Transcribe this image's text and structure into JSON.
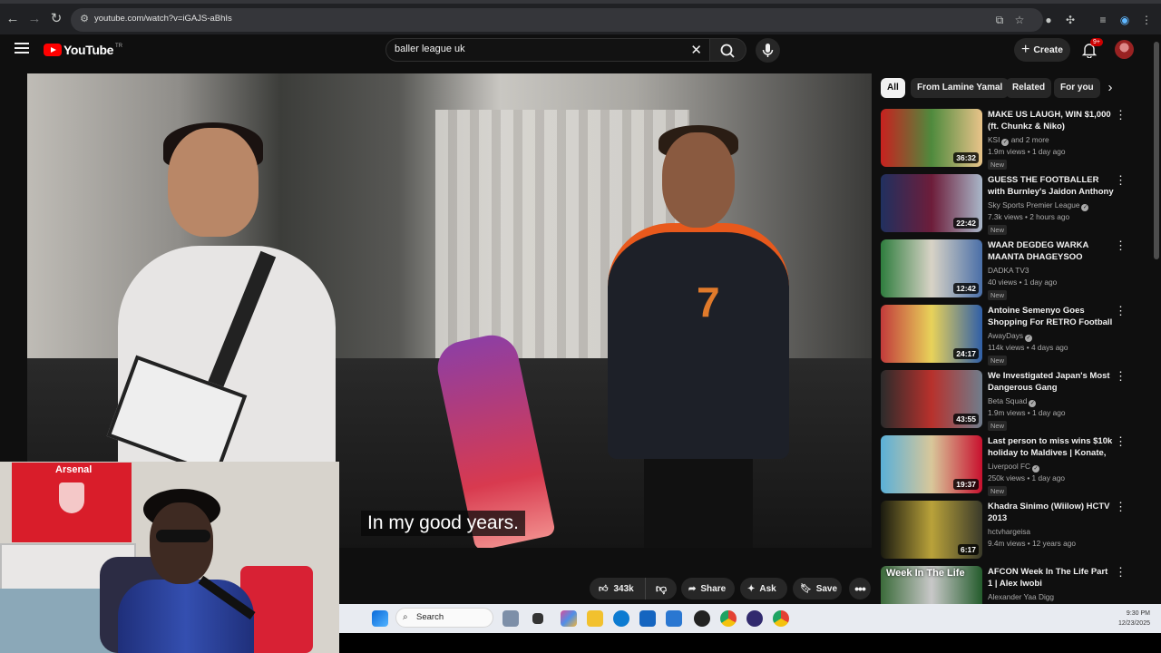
{
  "browser": {
    "url": "youtube.com/watch?v=iGAJS-aBhIs"
  },
  "header": {
    "logo_text": "YouTube",
    "logo_sup": "TR",
    "search_value": "baller league uk",
    "create_label": "Create",
    "notif_count": "9+"
  },
  "video": {
    "caption": "In my good years.",
    "jersey_number": "7"
  },
  "webcam": {
    "flag_text": "Arsenal"
  },
  "actions": {
    "like_count": "343k",
    "share": "Share",
    "ask": "Ask",
    "save": "Save"
  },
  "chips": [
    "All",
    "From Lamine Yamal",
    "Related",
    "For you"
  ],
  "recommendations": [
    {
      "title": "MAKE US LAUGH, WIN $1,000 (ft. Chunkz & Niko)",
      "channel": "KSI",
      "channel_extra": "and 2 more",
      "verified": true,
      "meta": "1.9m views • 1 day ago",
      "badge": "New",
      "duration": "36:32",
      "colors": [
        "#c8211f",
        "#4f8a3d",
        "#e9c48a"
      ]
    },
    {
      "title": "GUESS THE FOOTBALLER with Burnley's Jaidon Anthony & ...",
      "channel": "Sky Sports Premier League",
      "channel_extra": "",
      "verified": true,
      "meta": "7.3k views • 2 hours ago",
      "badge": "New",
      "duration": "22:42",
      "colors": [
        "#20305f",
        "#6d1d3a",
        "#a9b7c9"
      ]
    },
    {
      "title": "WAAR DEGDEG WARKA MAANTA DHAGEYSOO #XOGTA",
      "channel": "DADKA TV3",
      "channel_extra": "",
      "verified": false,
      "meta": "40 views • 1 day ago",
      "badge": "New",
      "duration": "12:42",
      "colors": [
        "#2f7d3e",
        "#d8d3c6",
        "#4a6fa8"
      ]
    },
    {
      "title": "Antoine Semenyo Goes Shopping For RETRO Football ...",
      "channel": "AwayDays",
      "channel_extra": "",
      "verified": true,
      "meta": "114k views • 4 days ago",
      "badge": "New",
      "duration": "24:17",
      "colors": [
        "#c23b3b",
        "#e8d25a",
        "#2f5fa8"
      ]
    },
    {
      "title": "We Investigated Japan's Most Dangerous Gang",
      "channel": "Beta Squad",
      "channel_extra": "",
      "verified": true,
      "meta": "1.9m views • 1 day ago",
      "badge": "New",
      "duration": "43:55",
      "colors": [
        "#2b2b2b",
        "#b8312c",
        "#6f7d8c"
      ]
    },
    {
      "title": "Last person to miss wins $10k holiday to Maldives | Konate, ...",
      "channel": "Liverpool FC",
      "channel_extra": "",
      "verified": true,
      "meta": "250k views • 1 day ago",
      "badge": "New",
      "duration": "19:37",
      "colors": [
        "#5ab0d8",
        "#d8c79a",
        "#c8102e"
      ]
    },
    {
      "title": "Khadra Sinimo (Wiilow) HCTV 2013",
      "channel": "hctvhargeisa",
      "channel_extra": "",
      "verified": false,
      "meta": "9.4m views • 12 years ago",
      "badge": "",
      "duration": "6:17",
      "colors": [
        "#1a1a10",
        "#b9a23a",
        "#3a3a2a"
      ]
    },
    {
      "title": "AFCON Week In The Life Part 1 | Alex Iwobi",
      "channel": "Alexander Yaa Digg",
      "channel_extra": "",
      "verified": false,
      "meta": "",
      "badge": "",
      "duration": "",
      "colors": [
        "#3b6b3a",
        "#c8c8c8",
        "#245c2c"
      ],
      "thumb_text": "Week In The Life"
    }
  ],
  "taskbar": {
    "search_label": "Search",
    "time": "9:30 PM",
    "date": "12/23/2025"
  },
  "colors": {
    "brand_red": "#ff0000",
    "bg": "#0f0f0f",
    "chip_bg": "#272727"
  }
}
